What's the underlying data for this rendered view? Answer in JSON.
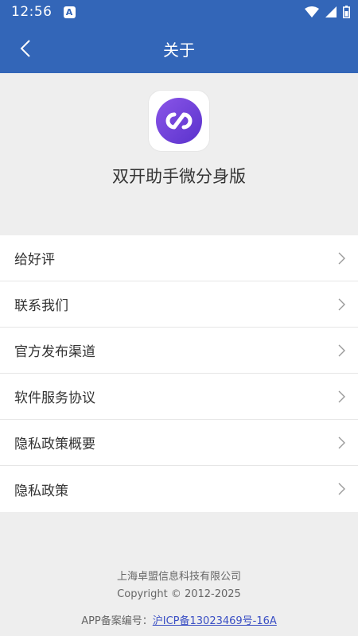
{
  "status_bar": {
    "time": "12:56",
    "notification_icon": "a-notification-icon",
    "wifi_icon": "wifi-icon",
    "signal_icon": "signal-icon",
    "battery_icon": "battery-icon"
  },
  "header": {
    "title": "关于",
    "back_icon": "chevron-left-icon",
    "background_color": "#3366b8"
  },
  "app": {
    "name": "双开助手微分身版",
    "icon": "infinity-logo-icon",
    "icon_color": "#6a3fd8"
  },
  "menu": {
    "items": [
      {
        "label": "给好评"
      },
      {
        "label": "联系我们"
      },
      {
        "label": "官方发布渠道"
      },
      {
        "label": "软件服务协议"
      },
      {
        "label": "隐私政策概要"
      },
      {
        "label": "隐私政策"
      }
    ]
  },
  "footer": {
    "company": "上海卓盟信息科技有限公司",
    "copyright": "Copyright © 2012-2025",
    "icp_prefix": "APP备案编号：",
    "icp_number": "沪ICP备13023469号-16A",
    "link_color": "#3a4fc4"
  }
}
